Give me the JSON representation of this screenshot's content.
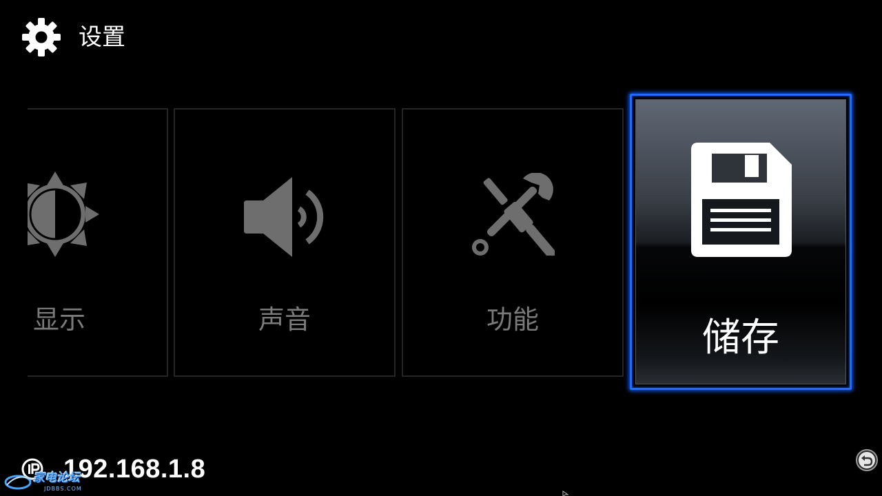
{
  "header": {
    "icon": "gear-icon",
    "title": "设置"
  },
  "tiles": [
    {
      "id": "display",
      "icon": "brightness-icon",
      "label": "显示",
      "selected": false
    },
    {
      "id": "sound",
      "icon": "speaker-icon",
      "label": "声音",
      "selected": false
    },
    {
      "id": "function",
      "icon": "tools-icon",
      "label": "功能",
      "selected": false
    },
    {
      "id": "storage",
      "icon": "floppy-disk-icon",
      "label": "储存",
      "selected": true
    }
  ],
  "footer": {
    "ip_icon": "ip-icon",
    "ip_address": "192.168.1.8",
    "back_icon": "back-icon"
  },
  "watermark": {
    "text": "家电论坛",
    "sub": "JDBBS.COM"
  },
  "colors": {
    "background": "#000000",
    "selection_border": "#1f6cff",
    "inactive_icon": "#6e6e6e",
    "inactive_label": "#7a7a7a",
    "active_text": "#ffffff"
  }
}
